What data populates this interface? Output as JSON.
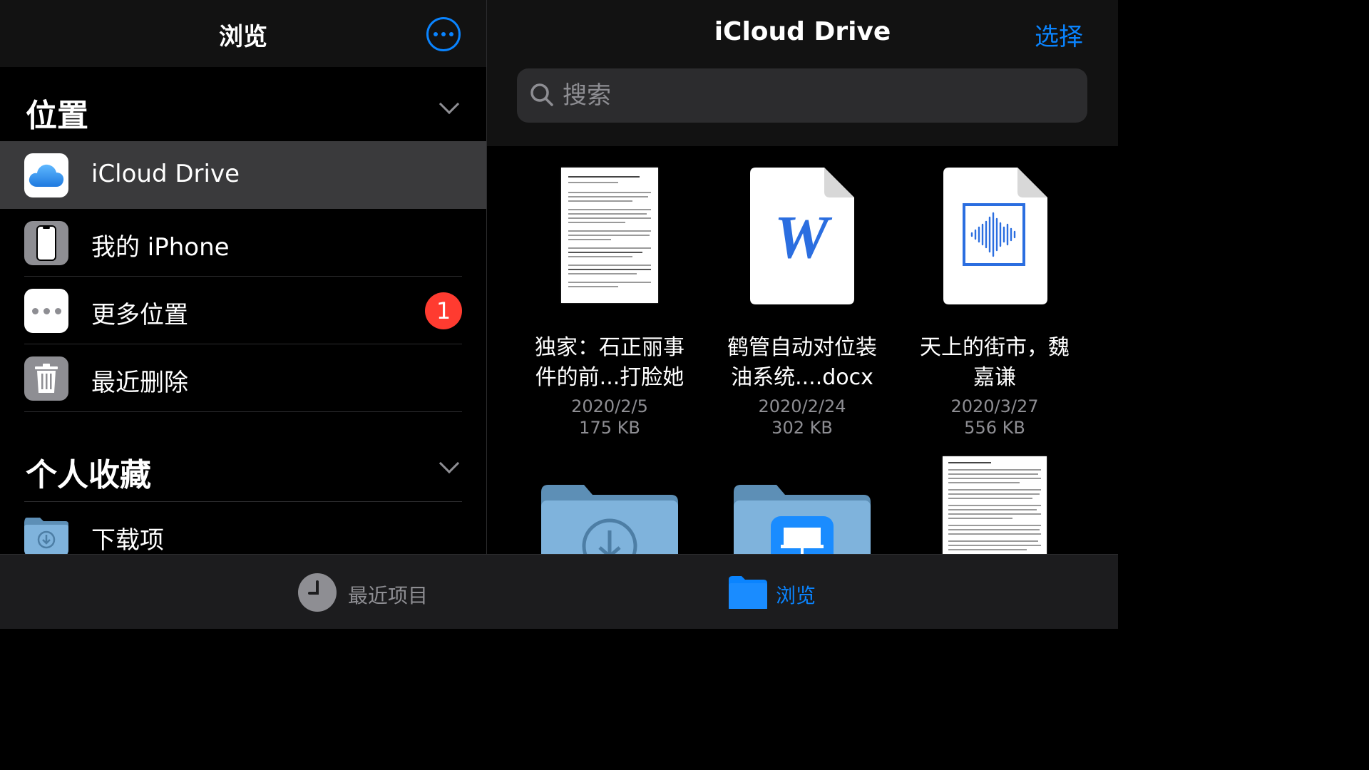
{
  "sidebar": {
    "title": "浏览",
    "sections": {
      "locations": "位置",
      "favorites": "个人收藏"
    },
    "locations": [
      {
        "label": "iCloud Drive",
        "icon": "icloud-icon",
        "selected": true
      },
      {
        "label": "我的 iPhone",
        "icon": "iphone-icon"
      },
      {
        "label": "更多位置",
        "icon": "more-dots-icon",
        "badge": "1"
      },
      {
        "label": "最近删除",
        "icon": "trash-icon"
      }
    ],
    "favorites": [
      {
        "label": "下载项",
        "icon": "downloads-folder-icon"
      }
    ]
  },
  "main": {
    "title": "iCloud Drive",
    "select_label": "选择",
    "search_placeholder": "搜索",
    "files": [
      {
        "name_line1": "独家：石正丽事",
        "name_line2": "件的前...打脸她",
        "date": "2020/2/5",
        "size": "175 KB",
        "type": "pdf-document"
      },
      {
        "name_line1": "鹤管自动对位装",
        "name_line2": "油系统....docx",
        "date": "2020/2/24",
        "size": "302 KB",
        "type": "word-document"
      },
      {
        "name_line1": "天上的街市，魏",
        "name_line2": "嘉谦",
        "date": "2020/3/27",
        "size": "556 KB",
        "type": "audio-file"
      },
      {
        "type": "downloads-folder"
      },
      {
        "type": "keynote-folder"
      },
      {
        "type": "text-document"
      }
    ]
  },
  "tabbar": {
    "recents": "最近项目",
    "browse": "浏览"
  },
  "colors": {
    "accent": "#0a84ff",
    "badge": "#ff3b30",
    "selected_row": "#3a3a3c",
    "secondary_text": "#8e8e93"
  }
}
